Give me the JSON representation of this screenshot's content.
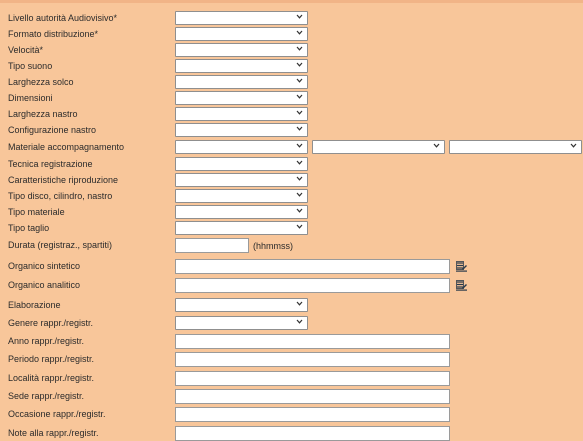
{
  "form": {
    "livello": {
      "label": "Livello autorità Audiovisivo*",
      "value": ""
    },
    "formato": {
      "label": "Formato distribuzione*",
      "value": ""
    },
    "velocita": {
      "label": "Velocità*",
      "value": ""
    },
    "tipo_suono": {
      "label": "Tipo suono",
      "value": ""
    },
    "larghezza_solco": {
      "label": "Larghezza solco",
      "value": ""
    },
    "dimensioni": {
      "label": "Dimensioni",
      "value": ""
    },
    "larghezza_nastro": {
      "label": "Larghezza nastro",
      "value": ""
    },
    "configurazione_nastro": {
      "label": "Configurazione nastro",
      "value": ""
    },
    "materiale": {
      "label": "Materiale accompagnamento",
      "value1": "",
      "value2": "",
      "value3": ""
    },
    "tecnica": {
      "label": "Tecnica registrazione",
      "value": ""
    },
    "caratteristiche": {
      "label": "Caratteristiche riproduzione",
      "value": ""
    },
    "tipo_disco": {
      "label": "Tipo disco, cilindro, nastro",
      "value": ""
    },
    "tipo_materiale": {
      "label": "Tipo materiale",
      "value": ""
    },
    "tipo_taglio": {
      "label": "Tipo taglio",
      "value": ""
    },
    "durata": {
      "label": "Durata (registraz., spartiti)",
      "value": "",
      "suffix": "(hhmmss)"
    },
    "organico_sintetico": {
      "label": "Organico sintetico",
      "value": ""
    },
    "organico_analitico": {
      "label": "Organico analitico",
      "value": ""
    },
    "elaborazione": {
      "label": "Elaborazione",
      "value": ""
    },
    "genere": {
      "label": "Genere rappr./registr.",
      "value": ""
    },
    "anno": {
      "label": "Anno rappr./registr.",
      "value": ""
    },
    "periodo": {
      "label": "Periodo rappr./registr.",
      "value": ""
    },
    "localita": {
      "label": "Località rappr./registr.",
      "value": ""
    },
    "sede": {
      "label": "Sede rappr./registr.",
      "value": ""
    },
    "occasione": {
      "label": "Occasione rappr./registr.",
      "value": ""
    },
    "note": {
      "label": "Note alla rappr./registr.",
      "value": ""
    }
  },
  "icons": {
    "dropdown": "chevron-down-icon",
    "picker": "lookup-table-icon"
  },
  "colors": {
    "background": "#f8c69a",
    "field": "#ffffff",
    "border": "#8f8f8f",
    "icon": "#2a3a4a"
  }
}
